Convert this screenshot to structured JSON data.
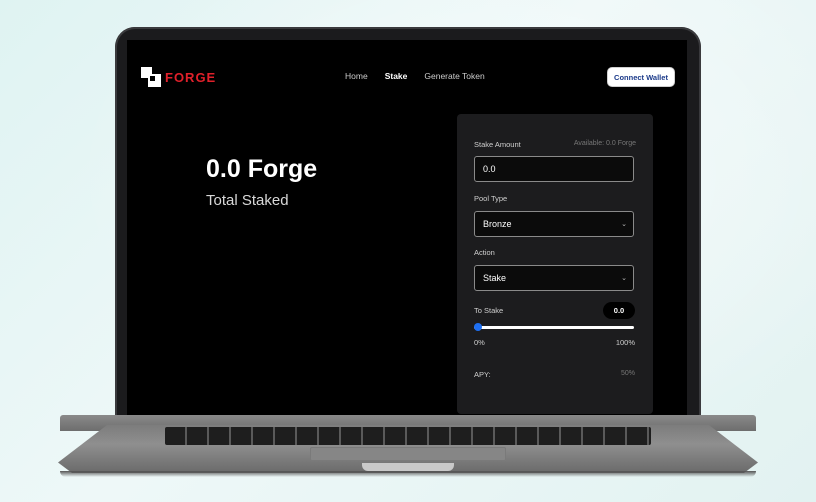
{
  "brand": {
    "name": "FORGE"
  },
  "nav": {
    "items": [
      "Home",
      "Stake",
      "Generate Token"
    ],
    "active": "Stake"
  },
  "header": {
    "connect_wallet": "Connect Wallet"
  },
  "summary": {
    "total_value": "0.0 Forge",
    "total_label": "Total Staked"
  },
  "stake_panel": {
    "stake_amount_label": "Stake Amount",
    "available": "Available: 0.0 Forge",
    "stake_amount_value": "0.0",
    "pool_type_label": "Pool Type",
    "pool_type_value": "Bronze",
    "action_label": "Action",
    "action_value": "Stake",
    "to_stake_label": "To Stake",
    "to_stake_value": "0.0",
    "slider": {
      "fraction": 0,
      "min_label": "0%",
      "max_label": "100%"
    },
    "apy_label": "APY:",
    "apy_value": "50%"
  },
  "colors": {
    "brand_red": "#e0202a",
    "slider_blue": "#1e6ff2",
    "panel_bg": "#1c1c1e",
    "page_bg": "#e6f5f4"
  }
}
